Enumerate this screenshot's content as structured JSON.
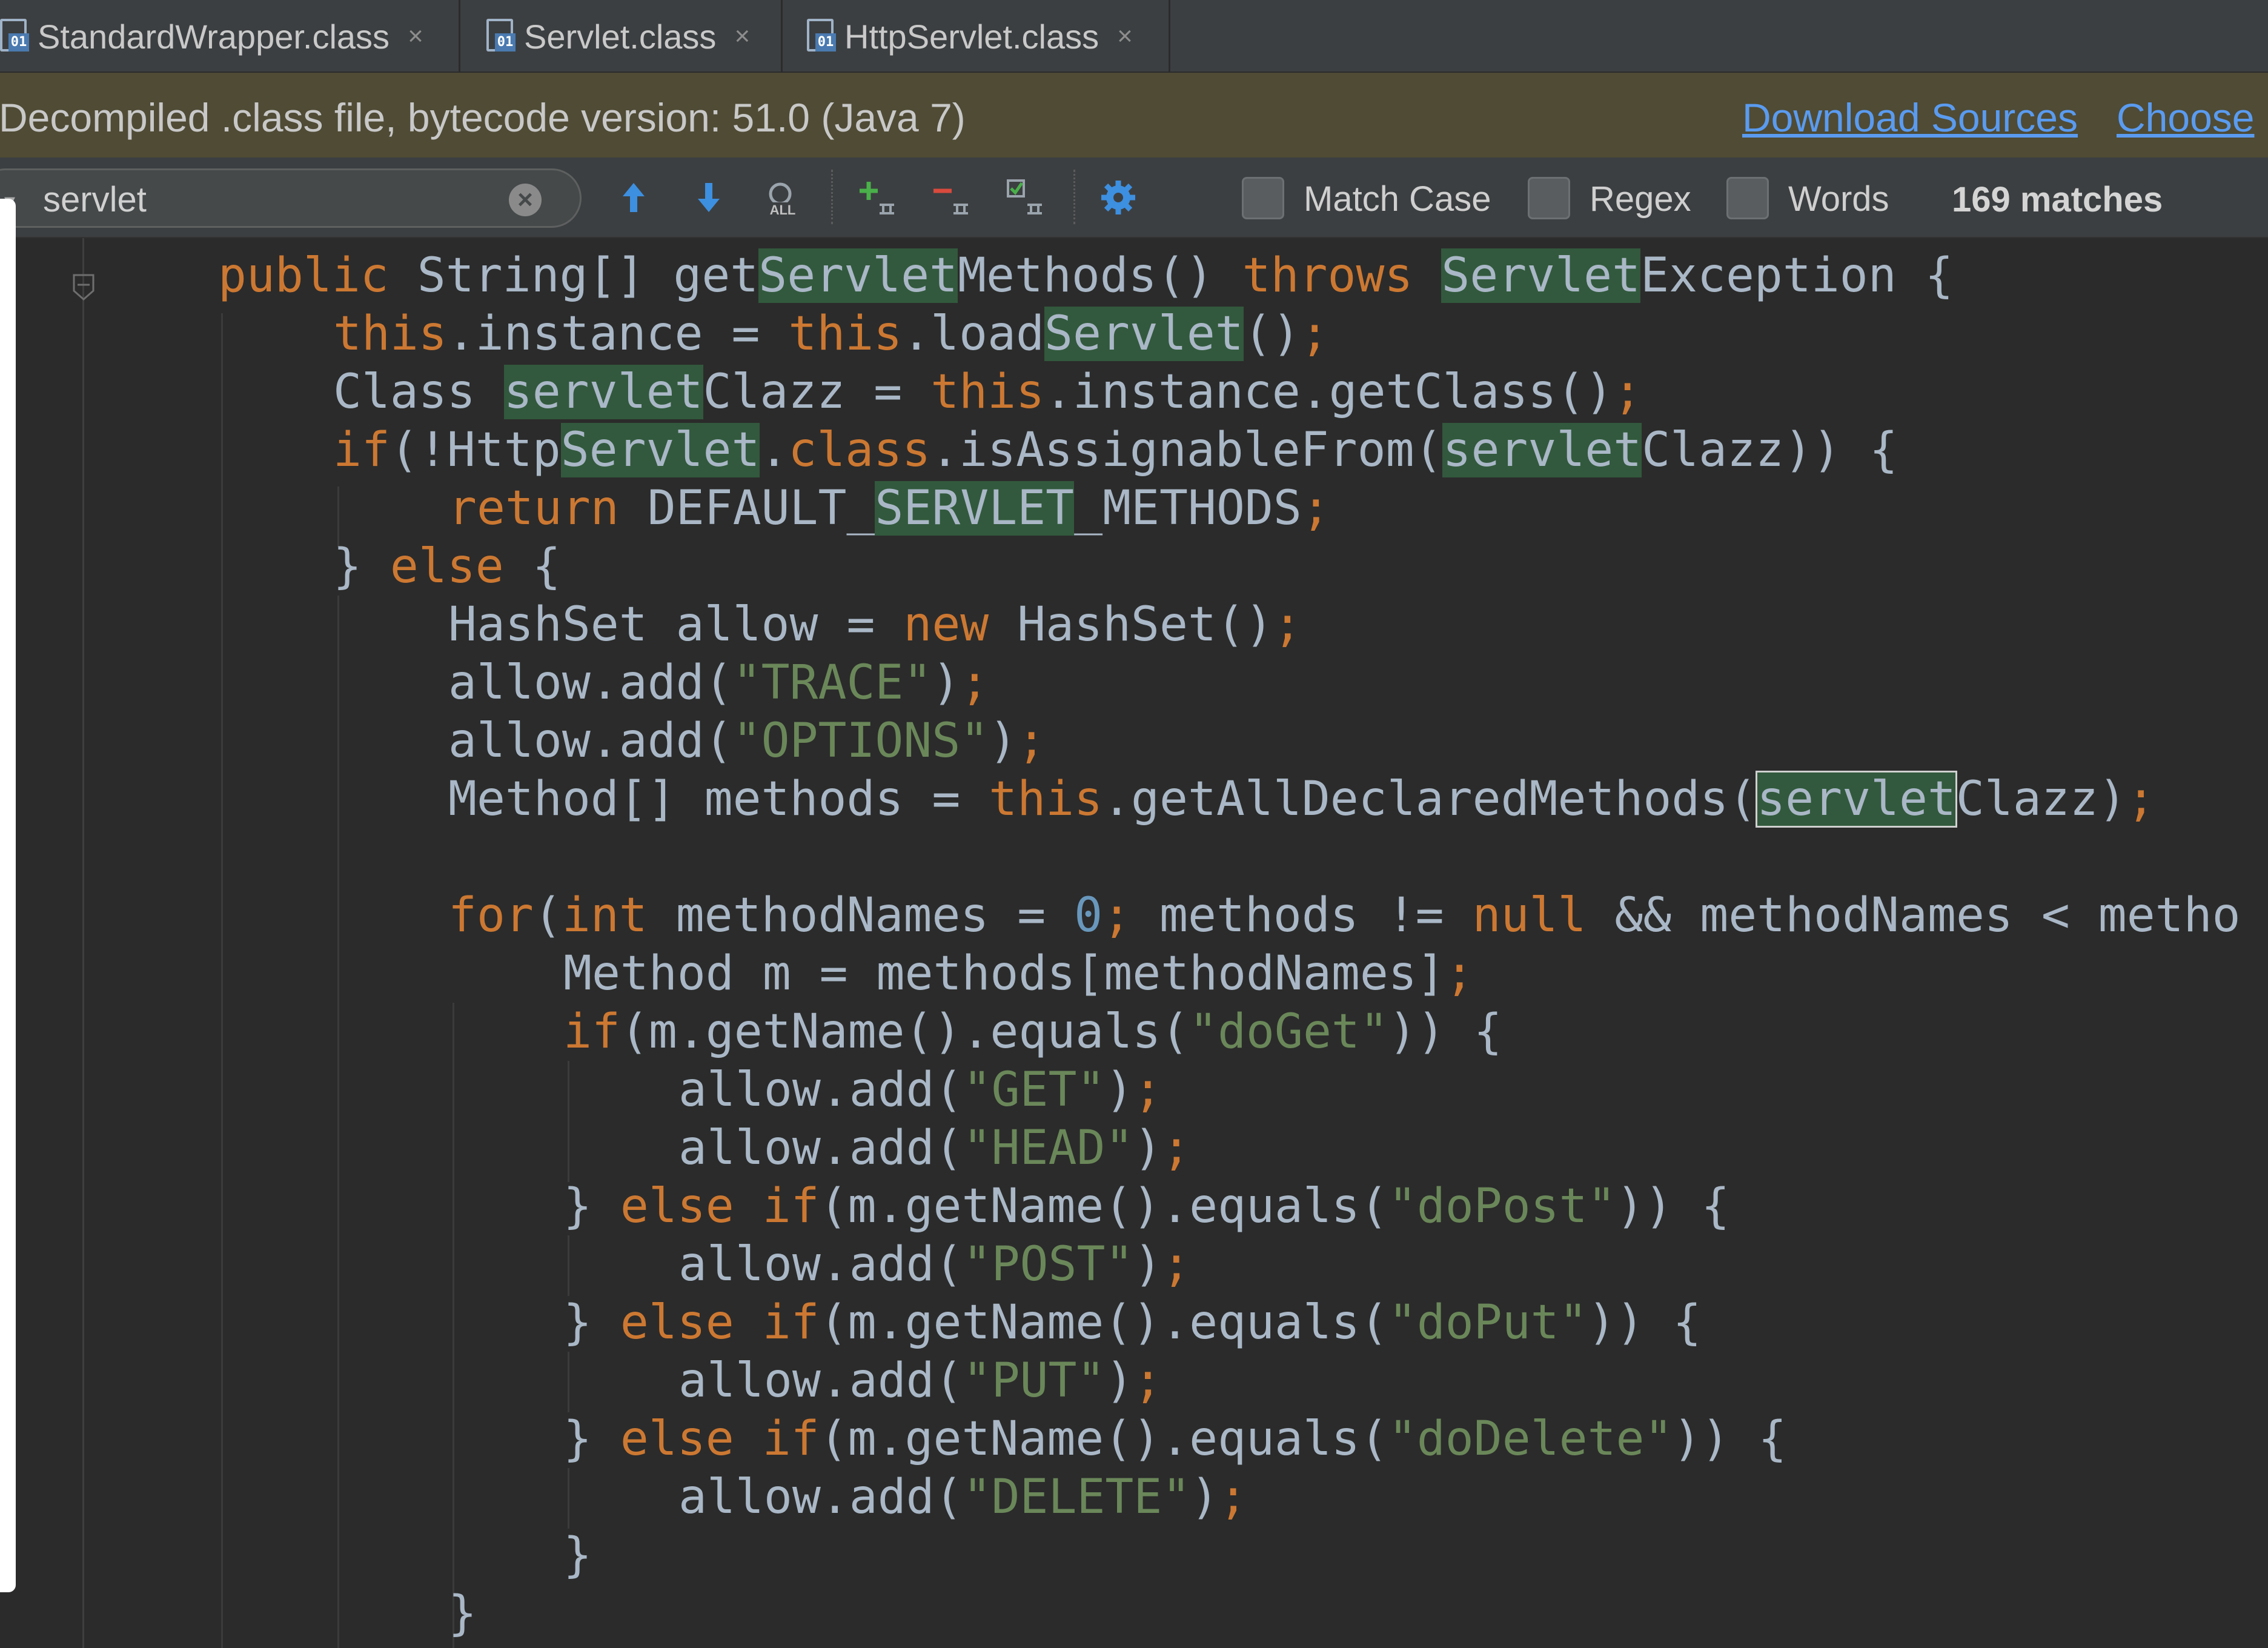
{
  "tabs": [
    {
      "label": "StandardWrapper.class",
      "icon": "class-file-icon",
      "close": "×"
    },
    {
      "label": "Servlet.class",
      "icon": "class-file-icon",
      "close": "×"
    },
    {
      "label": "HttpServlet.class",
      "icon": "class-file-icon",
      "close": "×"
    }
  ],
  "banner": {
    "text": "Decompiled .class file, bytecode version: 51.0 (Java 7)",
    "download_sources": "Download Sources",
    "choose": "Choose"
  },
  "search": {
    "query": "servlet",
    "clear": "×",
    "match_case": "Match Case",
    "regex": "Regex",
    "words": "Words",
    "matches": "169 matches",
    "all_label": "ALL"
  },
  "colors": {
    "keyword": "#cc7832",
    "string": "#6a8759",
    "number": "#6897bb",
    "identifier": "#a9b7c6",
    "match_highlight": "#32593d",
    "banner_bg": "#4f4b35",
    "link": "#5a9bf0"
  },
  "code_lines": [
    {
      "indent": 2,
      "segments": [
        [
          "kw",
          "public "
        ],
        [
          "t",
          "String[] get"
        ],
        [
          "hl",
          "Servlet"
        ],
        [
          "t",
          "Methods() "
        ],
        [
          "kw",
          "throws "
        ],
        [
          "hl",
          "Servlet"
        ],
        [
          "t",
          "Exception {"
        ]
      ]
    },
    {
      "indent": 3,
      "segments": [
        [
          "kw",
          "this"
        ],
        [
          "t",
          ".instance = "
        ],
        [
          "kw",
          "this"
        ],
        [
          "t",
          ".load"
        ],
        [
          "hl",
          "Servlet"
        ],
        [
          "t",
          "()"
        ],
        [
          "kw",
          ";"
        ]
      ]
    },
    {
      "indent": 3,
      "segments": [
        [
          "t",
          "Class "
        ],
        [
          "hl",
          "servlet"
        ],
        [
          "t",
          "Clazz = "
        ],
        [
          "kw",
          "this"
        ],
        [
          "t",
          ".instance.getClass()"
        ],
        [
          "kw",
          ";"
        ]
      ]
    },
    {
      "indent": 3,
      "segments": [
        [
          "kw",
          "if"
        ],
        [
          "t",
          "(!Http"
        ],
        [
          "hl",
          "Servlet"
        ],
        [
          "t",
          "."
        ],
        [
          "kw",
          "class"
        ],
        [
          "t",
          ".isAssignableFrom("
        ],
        [
          "hl",
          "servlet"
        ],
        [
          "t",
          "Clazz)) {"
        ]
      ]
    },
    {
      "indent": 4,
      "segments": [
        [
          "kw",
          "return "
        ],
        [
          "t",
          "DEFAULT_"
        ],
        [
          "hl",
          "SERVLET"
        ],
        [
          "t",
          "_METHODS"
        ],
        [
          "kw",
          ";"
        ]
      ]
    },
    {
      "indent": 3,
      "segments": [
        [
          "t",
          "} "
        ],
        [
          "kw",
          "else "
        ],
        [
          "t",
          "{"
        ]
      ]
    },
    {
      "indent": 4,
      "segments": [
        [
          "t",
          "HashSet allow = "
        ],
        [
          "kw",
          "new "
        ],
        [
          "t",
          "HashSet()"
        ],
        [
          "kw",
          ";"
        ]
      ]
    },
    {
      "indent": 4,
      "segments": [
        [
          "t",
          "allow.add("
        ],
        [
          "str",
          "\"TRACE\""
        ],
        [
          "t",
          ")"
        ],
        [
          "kw",
          ";"
        ]
      ]
    },
    {
      "indent": 4,
      "segments": [
        [
          "t",
          "allow.add("
        ],
        [
          "str",
          "\"OPTIONS\""
        ],
        [
          "t",
          ")"
        ],
        [
          "kw",
          ";"
        ]
      ]
    },
    {
      "indent": 4,
      "segments": [
        [
          "t",
          "Method[] methods = "
        ],
        [
          "kw",
          "this"
        ],
        [
          "t",
          ".getAllDeclaredMethods("
        ],
        [
          "hlc",
          "servlet"
        ],
        [
          "t",
          "Clazz)"
        ],
        [
          "kw",
          ";"
        ]
      ]
    },
    {
      "indent": 0,
      "segments": []
    },
    {
      "indent": 4,
      "segments": [
        [
          "kw",
          "for"
        ],
        [
          "t",
          "("
        ],
        [
          "kw",
          "int "
        ],
        [
          "t",
          "methodNames = "
        ],
        [
          "num",
          "0"
        ],
        [
          "kw",
          "; "
        ],
        [
          "t",
          "methods != "
        ],
        [
          "kw",
          "null "
        ],
        [
          "t",
          "&& methodNames < metho"
        ]
      ]
    },
    {
      "indent": 5,
      "segments": [
        [
          "t",
          "Method m = methods[methodNames]"
        ],
        [
          "kw",
          ";"
        ]
      ]
    },
    {
      "indent": 5,
      "segments": [
        [
          "kw",
          "if"
        ],
        [
          "t",
          "(m.getName().equals("
        ],
        [
          "str",
          "\"doGet\""
        ],
        [
          "t",
          ")) {"
        ]
      ]
    },
    {
      "indent": 6,
      "segments": [
        [
          "t",
          "allow.add("
        ],
        [
          "str",
          "\"GET\""
        ],
        [
          "t",
          ")"
        ],
        [
          "kw",
          ";"
        ]
      ]
    },
    {
      "indent": 6,
      "segments": [
        [
          "t",
          "allow.add("
        ],
        [
          "str",
          "\"HEAD\""
        ],
        [
          "t",
          ")"
        ],
        [
          "kw",
          ";"
        ]
      ]
    },
    {
      "indent": 5,
      "segments": [
        [
          "t",
          "} "
        ],
        [
          "kw",
          "else if"
        ],
        [
          "t",
          "(m.getName().equals("
        ],
        [
          "str",
          "\"doPost\""
        ],
        [
          "t",
          ")) {"
        ]
      ]
    },
    {
      "indent": 6,
      "segments": [
        [
          "t",
          "allow.add("
        ],
        [
          "str",
          "\"POST\""
        ],
        [
          "t",
          ")"
        ],
        [
          "kw",
          ";"
        ]
      ]
    },
    {
      "indent": 5,
      "segments": [
        [
          "t",
          "} "
        ],
        [
          "kw",
          "else if"
        ],
        [
          "t",
          "(m.getName().equals("
        ],
        [
          "str",
          "\"doPut\""
        ],
        [
          "t",
          ")) {"
        ]
      ]
    },
    {
      "indent": 6,
      "segments": [
        [
          "t",
          "allow.add("
        ],
        [
          "str",
          "\"PUT\""
        ],
        [
          "t",
          ")"
        ],
        [
          "kw",
          ";"
        ]
      ]
    },
    {
      "indent": 5,
      "segments": [
        [
          "t",
          "} "
        ],
        [
          "kw",
          "else if"
        ],
        [
          "t",
          "(m.getName().equals("
        ],
        [
          "str",
          "\"doDelete\""
        ],
        [
          "t",
          ")) {"
        ]
      ]
    },
    {
      "indent": 6,
      "segments": [
        [
          "t",
          "allow.add("
        ],
        [
          "str",
          "\"DELETE\""
        ],
        [
          "t",
          ")"
        ],
        [
          "kw",
          ";"
        ]
      ]
    },
    {
      "indent": 5,
      "segments": [
        [
          "t",
          "}"
        ]
      ]
    },
    {
      "indent": 4,
      "segments": [
        [
          "t",
          "}"
        ]
      ]
    }
  ]
}
